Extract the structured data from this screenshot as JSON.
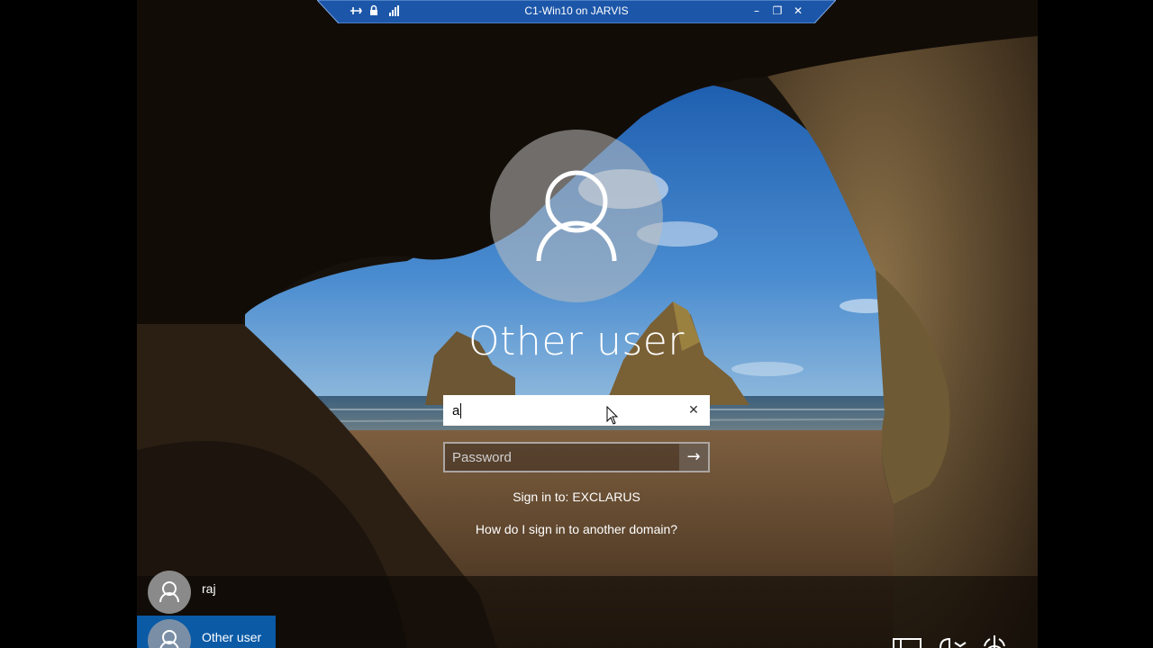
{
  "rdp_bar": {
    "title": "C1-Win10 on JARVIS",
    "left_icons": [
      "pin-icon",
      "lock-icon",
      "signal-icon"
    ],
    "right_icons": [
      "minimize-icon",
      "restore-icon",
      "close-icon"
    ],
    "minimize_glyph": "–",
    "restore_glyph": "❐",
    "close_glyph": "✕"
  },
  "login": {
    "user_name": "Other user",
    "username_value": "a",
    "clear_glyph": "✕",
    "password_placeholder": "Password",
    "submit_glyph": "→",
    "signin_to": "Sign in to: EXCLARUS",
    "other_domain_link": "How do I sign in to another domain?"
  },
  "user_list": [
    {
      "label": "raj",
      "selected": false
    },
    {
      "label": "Other user",
      "selected": true
    }
  ],
  "system_icons": [
    "network-icon",
    "ease-of-access-icon",
    "power-icon"
  ],
  "colors": {
    "rdp_bar": "#1c56a8",
    "selected_user": "#0a5aa6"
  }
}
